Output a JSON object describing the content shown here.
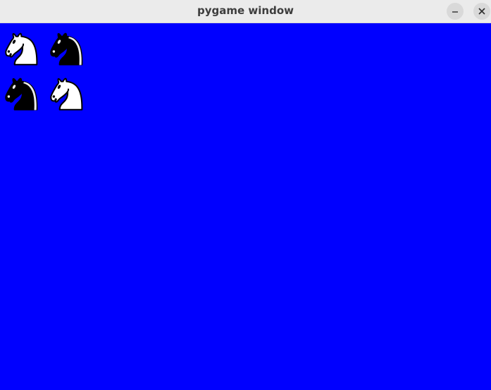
{
  "window": {
    "title": "pygame window",
    "background_color": "#0000ff",
    "titlebar_color": "#ebebeb"
  },
  "controls": {
    "minimize_icon": "minimize-icon",
    "close_icon": "close-icon"
  },
  "board": {
    "pieces": [
      {
        "piece": "knight",
        "color": "white",
        "icon": "white-knight-icon"
      },
      {
        "piece": "knight",
        "color": "black",
        "icon": "black-knight-icon"
      },
      {
        "piece": "knight",
        "color": "black",
        "icon": "black-knight-icon"
      },
      {
        "piece": "knight",
        "color": "white",
        "icon": "white-knight-icon"
      }
    ]
  }
}
